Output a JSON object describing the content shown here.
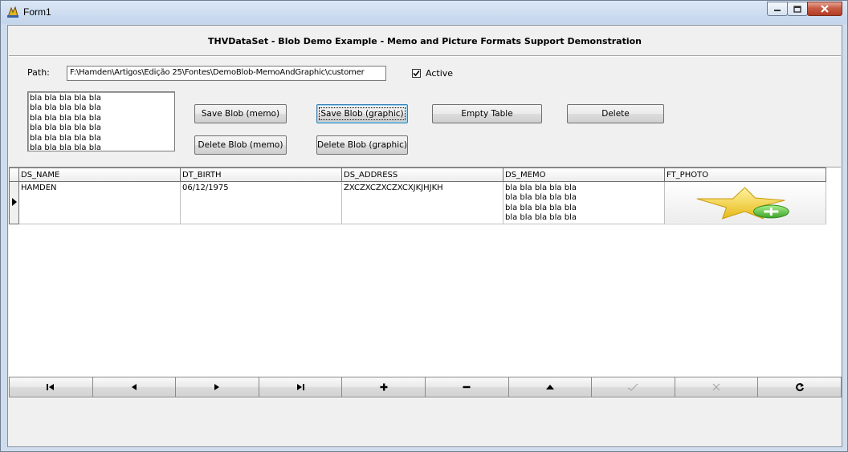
{
  "window": {
    "title": "Form1"
  },
  "header": {
    "title": "THVDataSet - Blob Demo Example - Memo and Picture Formats Support Demonstration"
  },
  "path": {
    "label": "Path:",
    "value": "F:\\Hamden\\Artigos\\Edição 25\\Fontes\\DemoBlob-MemoAndGraphic\\customer"
  },
  "active": {
    "label": "Active",
    "checked": true
  },
  "memo": {
    "lines": [
      "bla bla bla bla bla",
      "bla bla bla bla bla",
      "bla bla bla bla bla",
      "bla bla bla bla bla",
      "bla bla bla bla bla",
      "bla bla bla bla bla"
    ]
  },
  "buttons": {
    "save_blob_memo": "Save Blob (memo)",
    "save_blob_graphic": "Save Blob (graphic)",
    "empty_table": "Empty Table",
    "delete": "Delete",
    "delete_blob_memo": "Delete Blob (memo)",
    "delete_blob_graphic": "Delete Blob (graphic)"
  },
  "grid": {
    "columns": [
      "DS_NAME",
      "DT_BIRTH",
      "DS_ADDRESS",
      "DS_MEMO",
      "FT_PHOTO"
    ],
    "rows": [
      {
        "ds_name": "HAMDEN",
        "dt_birth": "06/12/1975",
        "ds_address": "ZXCZXCZXCZXCXJKJHJKH",
        "ds_memo": [
          "bla bla bla bla bla",
          "bla bla bla bla bla",
          "bla bla bla bla bla",
          "bla bla bla bla bla"
        ],
        "ft_photo": "star-plus-icon"
      }
    ]
  },
  "navigator": {
    "buttons": [
      {
        "name": "first-record-icon",
        "enabled": true
      },
      {
        "name": "prior-record-icon",
        "enabled": true
      },
      {
        "name": "next-record-icon",
        "enabled": true
      },
      {
        "name": "last-record-icon",
        "enabled": true
      },
      {
        "name": "insert-record-icon",
        "enabled": true
      },
      {
        "name": "delete-record-icon",
        "enabled": true
      },
      {
        "name": "edit-record-icon",
        "enabled": true
      },
      {
        "name": "post-record-icon",
        "enabled": false
      },
      {
        "name": "cancel-record-icon",
        "enabled": false
      },
      {
        "name": "refresh-record-icon",
        "enabled": true
      }
    ]
  },
  "colors": {
    "star": "#f2d23a",
    "plus_badge": "#4fbf3a",
    "disabled_icon": "#a8a8a8"
  }
}
